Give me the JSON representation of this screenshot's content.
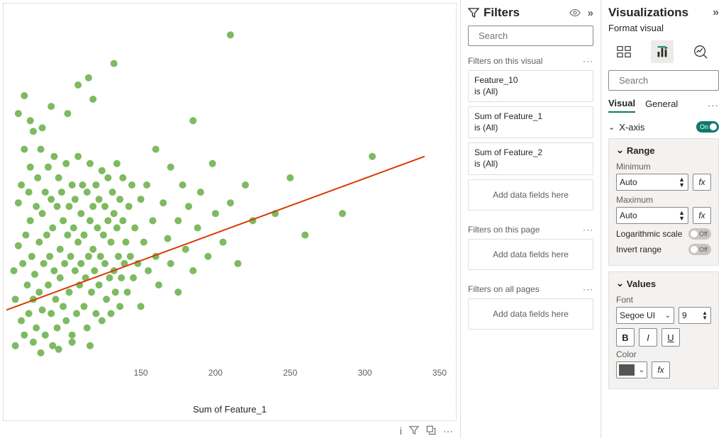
{
  "filters": {
    "title": "Filters",
    "search_placeholder": "Search",
    "sections": {
      "visual_title": "Filters on this visual",
      "page_title": "Filters on this page",
      "all_title": "Filters on all pages"
    },
    "visual_filters": [
      {
        "field": "Feature_10",
        "condition": "is (All)"
      },
      {
        "field": "Sum of Feature_1",
        "condition": "is (All)"
      },
      {
        "field": "Sum of Feature_2",
        "condition": "is (All)"
      }
    ],
    "dropzone_text": "Add data fields here"
  },
  "viz": {
    "title": "Visualizations",
    "subtitle": "Format visual",
    "search_placeholder": "Search",
    "tabs": {
      "visual": "Visual",
      "general": "General"
    },
    "xaxis": {
      "label": "X-axis",
      "range_label": "Range",
      "min_label": "Minimum",
      "min_value": "Auto",
      "max_label": "Maximum",
      "max_value": "Auto",
      "log_label": "Logarithmic scale",
      "invert_label": "Invert range"
    },
    "values": {
      "label": "Values",
      "font_label": "Font",
      "font_family": "Segoe UI",
      "font_size": "9",
      "color_label": "Color"
    },
    "fx_label": "fx",
    "bold": "B",
    "italic": "I",
    "underline": "U"
  },
  "chart_data": {
    "type": "scatter",
    "xlabel": "Sum of Feature_1",
    "x_ticks": [
      150,
      200,
      250,
      300,
      350
    ],
    "xlim": [
      60,
      360
    ],
    "ylim": [
      0,
      100
    ],
    "trendline": {
      "x1": 60,
      "y1": 15,
      "x2": 340,
      "y2": 58
    },
    "series": [
      {
        "name": "points",
        "color": "#6fb24f",
        "points": [
          [
            65,
            26
          ],
          [
            66,
            18
          ],
          [
            68,
            33
          ],
          [
            68,
            45
          ],
          [
            70,
            12
          ],
          [
            70,
            50
          ],
          [
            71,
            28
          ],
          [
            72,
            8
          ],
          [
            72,
            60
          ],
          [
            73,
            36
          ],
          [
            74,
            22
          ],
          [
            75,
            14
          ],
          [
            75,
            48
          ],
          [
            76,
            40
          ],
          [
            76,
            55
          ],
          [
            77,
            30
          ],
          [
            78,
            18
          ],
          [
            78,
            65
          ],
          [
            79,
            25
          ],
          [
            80,
            10
          ],
          [
            80,
            44
          ],
          [
            81,
            52
          ],
          [
            82,
            34
          ],
          [
            82,
            20
          ],
          [
            83,
            60
          ],
          [
            84,
            15
          ],
          [
            84,
            42
          ],
          [
            85,
            28
          ],
          [
            86,
            48
          ],
          [
            86,
            8
          ],
          [
            87,
            36
          ],
          [
            88,
            55
          ],
          [
            88,
            22
          ],
          [
            89,
            30
          ],
          [
            90,
            14
          ],
          [
            90,
            46
          ],
          [
            91,
            38
          ],
          [
            92,
            26
          ],
          [
            92,
            58
          ],
          [
            93,
            18
          ],
          [
            94,
            44
          ],
          [
            94,
            10
          ],
          [
            95,
            52
          ],
          [
            96,
            32
          ],
          [
            96,
            24
          ],
          [
            97,
            48
          ],
          [
            98,
            16
          ],
          [
            98,
            40
          ],
          [
            99,
            28
          ],
          [
            100,
            56
          ],
          [
            100,
            12
          ],
          [
            101,
            36
          ],
          [
            102,
            44
          ],
          [
            102,
            20
          ],
          [
            103,
            30
          ],
          [
            104,
            50
          ],
          [
            104,
            8
          ],
          [
            105,
            38
          ],
          [
            106,
            26
          ],
          [
            106,
            46
          ],
          [
            107,
            14
          ],
          [
            108,
            34
          ],
          [
            108,
            58
          ],
          [
            109,
            22
          ],
          [
            110,
            42
          ],
          [
            110,
            28
          ],
          [
            111,
            50
          ],
          [
            112,
            16
          ],
          [
            112,
            36
          ],
          [
            113,
            24
          ],
          [
            114,
            48
          ],
          [
            114,
            10
          ],
          [
            115,
            30
          ],
          [
            116,
            40
          ],
          [
            116,
            56
          ],
          [
            117,
            20
          ],
          [
            118,
            44
          ],
          [
            118,
            32
          ],
          [
            119,
            26
          ],
          [
            120,
            14
          ],
          [
            120,
            50
          ],
          [
            121,
            38
          ],
          [
            122,
            22
          ],
          [
            122,
            46
          ],
          [
            123,
            30
          ],
          [
            124,
            54
          ],
          [
            124,
            12
          ],
          [
            125,
            36
          ],
          [
            126,
            28
          ],
          [
            126,
            44
          ],
          [
            127,
            18
          ],
          [
            128,
            40
          ],
          [
            128,
            52
          ],
          [
            129,
            24
          ],
          [
            130,
            34
          ],
          [
            130,
            14
          ],
          [
            131,
            48
          ],
          [
            132,
            26
          ],
          [
            132,
            42
          ],
          [
            133,
            20
          ],
          [
            134,
            38
          ],
          [
            134,
            56
          ],
          [
            135,
            30
          ],
          [
            136,
            46
          ],
          [
            136,
            16
          ],
          [
            137,
            24
          ],
          [
            138,
            40
          ],
          [
            138,
            52
          ],
          [
            139,
            28
          ],
          [
            140,
            34
          ],
          [
            141,
            20
          ],
          [
            142,
            44
          ],
          [
            143,
            30
          ],
          [
            144,
            50
          ],
          [
            145,
            24
          ],
          [
            146,
            38
          ],
          [
            148,
            28
          ],
          [
            150,
            46
          ],
          [
            150,
            16
          ],
          [
            152,
            34
          ],
          [
            154,
            50
          ],
          [
            155,
            26
          ],
          [
            158,
            40
          ],
          [
            160,
            30
          ],
          [
            160,
            60
          ],
          [
            162,
            22
          ],
          [
            165,
            45
          ],
          [
            168,
            35
          ],
          [
            170,
            28
          ],
          [
            170,
            55
          ],
          [
            175,
            40
          ],
          [
            175,
            20
          ],
          [
            178,
            50
          ],
          [
            180,
            32
          ],
          [
            182,
            44
          ],
          [
            185,
            68
          ],
          [
            185,
            26
          ],
          [
            188,
            38
          ],
          [
            190,
            48
          ],
          [
            195,
            30
          ],
          [
            198,
            56
          ],
          [
            200,
            42
          ],
          [
            205,
            34
          ],
          [
            210,
            45
          ],
          [
            210,
            92
          ],
          [
            215,
            28
          ],
          [
            220,
            50
          ],
          [
            225,
            40
          ],
          [
            240,
            42
          ],
          [
            250,
            52
          ],
          [
            260,
            36
          ],
          [
            285,
            42
          ],
          [
            305,
            58
          ],
          [
            108,
            78
          ],
          [
            115,
            80
          ],
          [
            132,
            84
          ],
          [
            90,
            72
          ],
          [
            72,
            75
          ],
          [
            83,
            3
          ],
          [
            95,
            4
          ],
          [
            68,
            70
          ],
          [
            76,
            68
          ],
          [
            84,
            66
          ],
          [
            101,
            70
          ],
          [
            118,
            74
          ],
          [
            66,
            5
          ],
          [
            78,
            6
          ],
          [
            91,
            5
          ],
          [
            104,
            6
          ],
          [
            116,
            5
          ]
        ]
      }
    ]
  }
}
